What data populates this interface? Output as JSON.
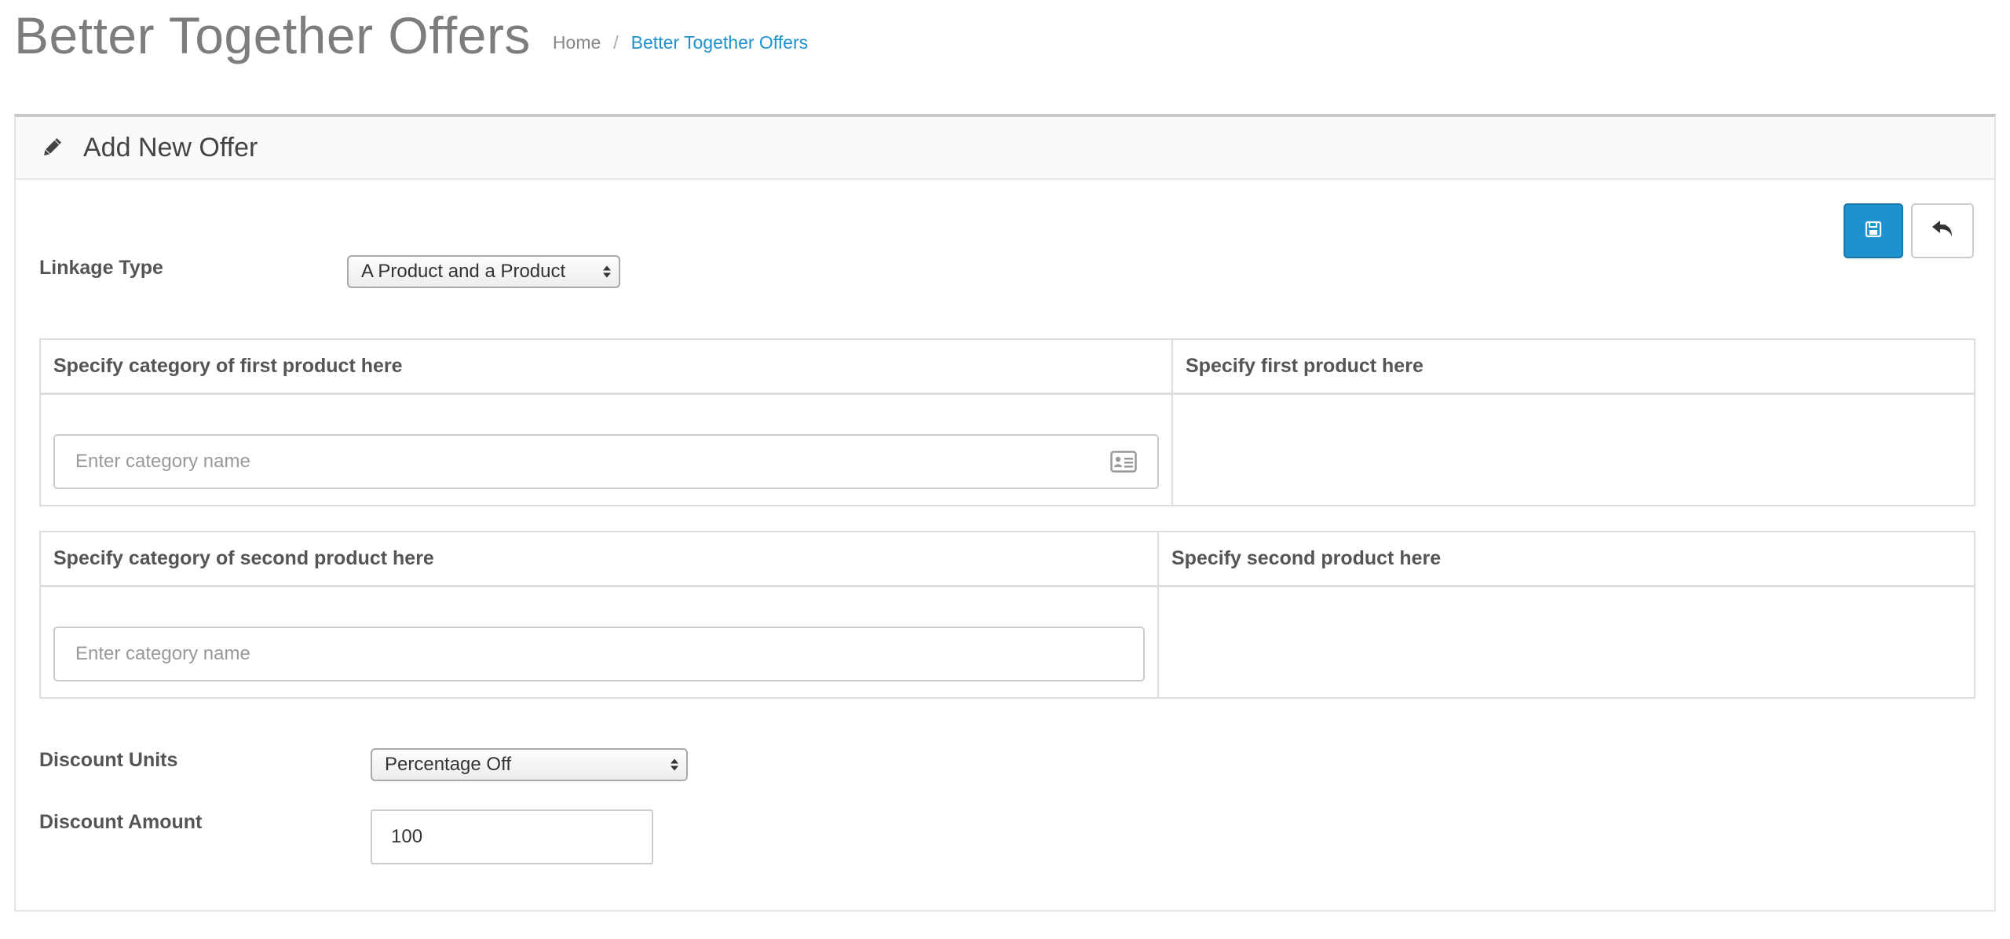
{
  "header": {
    "title": "Better Together Offers",
    "breadcrumb": {
      "home": "Home",
      "separator": "/",
      "current": "Better Together Offers"
    }
  },
  "panel": {
    "title": "Add New Offer",
    "icon": "pencil-icon"
  },
  "actions": {
    "save_icon": "save-icon",
    "back_icon": "reply-icon"
  },
  "form": {
    "linkage_type": {
      "label": "Linkage Type",
      "value": "A Product and a Product"
    },
    "first_table": {
      "col1_header": "Specify category of first product here",
      "col2_header": "Specify first product here",
      "category_placeholder": "Enter category name"
    },
    "second_table": {
      "col1_header": "Specify category of second product here",
      "col2_header": "Specify second product here",
      "category_placeholder": "Enter category name"
    },
    "discount_units": {
      "label": "Discount Units",
      "value": "Percentage Off"
    },
    "discount_amount": {
      "label": "Discount Amount",
      "value": "100"
    }
  },
  "colors": {
    "accent": "#1e91cf",
    "title_gray": "#7d7d7d",
    "border": "#dddddd"
  }
}
